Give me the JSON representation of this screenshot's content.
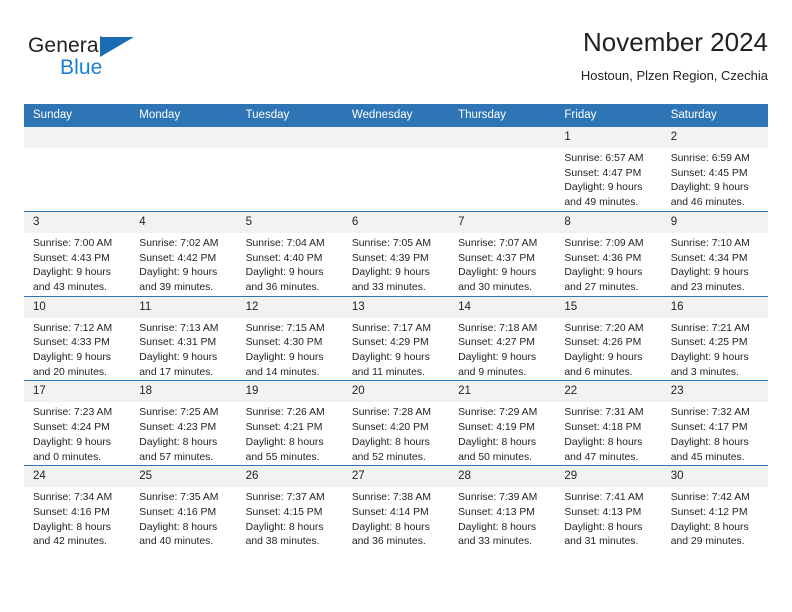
{
  "brand": {
    "word1": "General",
    "word2": "Blue",
    "triangle_color": "#1b6cb3",
    "blue_color": "#1b7ed6"
  },
  "header": {
    "title": "November 2024",
    "subtitle": "Hostoun, Plzen Region, Czechia"
  },
  "theme": {
    "header_bg": "#2e75b6",
    "daynum_bg": "#f2f2f2",
    "text": "#231f20"
  },
  "calendar": {
    "weekday_headers": [
      "Sunday",
      "Monday",
      "Tuesday",
      "Wednesday",
      "Thursday",
      "Friday",
      "Saturday"
    ],
    "weeks": [
      [
        {
          "day": "",
          "empty": true
        },
        {
          "day": "",
          "empty": true
        },
        {
          "day": "",
          "empty": true
        },
        {
          "day": "",
          "empty": true
        },
        {
          "day": "",
          "empty": true
        },
        {
          "day": "1",
          "sunrise": "Sunrise: 6:57 AM",
          "sunset": "Sunset: 4:47 PM",
          "daylight_1": "Daylight: 9 hours",
          "daylight_2": "and 49 minutes."
        },
        {
          "day": "2",
          "sunrise": "Sunrise: 6:59 AM",
          "sunset": "Sunset: 4:45 PM",
          "daylight_1": "Daylight: 9 hours",
          "daylight_2": "and 46 minutes."
        }
      ],
      [
        {
          "day": "3",
          "sunrise": "Sunrise: 7:00 AM",
          "sunset": "Sunset: 4:43 PM",
          "daylight_1": "Daylight: 9 hours",
          "daylight_2": "and 43 minutes."
        },
        {
          "day": "4",
          "sunrise": "Sunrise: 7:02 AM",
          "sunset": "Sunset: 4:42 PM",
          "daylight_1": "Daylight: 9 hours",
          "daylight_2": "and 39 minutes."
        },
        {
          "day": "5",
          "sunrise": "Sunrise: 7:04 AM",
          "sunset": "Sunset: 4:40 PM",
          "daylight_1": "Daylight: 9 hours",
          "daylight_2": "and 36 minutes."
        },
        {
          "day": "6",
          "sunrise": "Sunrise: 7:05 AM",
          "sunset": "Sunset: 4:39 PM",
          "daylight_1": "Daylight: 9 hours",
          "daylight_2": "and 33 minutes."
        },
        {
          "day": "7",
          "sunrise": "Sunrise: 7:07 AM",
          "sunset": "Sunset: 4:37 PM",
          "daylight_1": "Daylight: 9 hours",
          "daylight_2": "and 30 minutes."
        },
        {
          "day": "8",
          "sunrise": "Sunrise: 7:09 AM",
          "sunset": "Sunset: 4:36 PM",
          "daylight_1": "Daylight: 9 hours",
          "daylight_2": "and 27 minutes."
        },
        {
          "day": "9",
          "sunrise": "Sunrise: 7:10 AM",
          "sunset": "Sunset: 4:34 PM",
          "daylight_1": "Daylight: 9 hours",
          "daylight_2": "and 23 minutes."
        }
      ],
      [
        {
          "day": "10",
          "sunrise": "Sunrise: 7:12 AM",
          "sunset": "Sunset: 4:33 PM",
          "daylight_1": "Daylight: 9 hours",
          "daylight_2": "and 20 minutes."
        },
        {
          "day": "11",
          "sunrise": "Sunrise: 7:13 AM",
          "sunset": "Sunset: 4:31 PM",
          "daylight_1": "Daylight: 9 hours",
          "daylight_2": "and 17 minutes."
        },
        {
          "day": "12",
          "sunrise": "Sunrise: 7:15 AM",
          "sunset": "Sunset: 4:30 PM",
          "daylight_1": "Daylight: 9 hours",
          "daylight_2": "and 14 minutes."
        },
        {
          "day": "13",
          "sunrise": "Sunrise: 7:17 AM",
          "sunset": "Sunset: 4:29 PM",
          "daylight_1": "Daylight: 9 hours",
          "daylight_2": "and 11 minutes."
        },
        {
          "day": "14",
          "sunrise": "Sunrise: 7:18 AM",
          "sunset": "Sunset: 4:27 PM",
          "daylight_1": "Daylight: 9 hours",
          "daylight_2": "and 9 minutes."
        },
        {
          "day": "15",
          "sunrise": "Sunrise: 7:20 AM",
          "sunset": "Sunset: 4:26 PM",
          "daylight_1": "Daylight: 9 hours",
          "daylight_2": "and 6 minutes."
        },
        {
          "day": "16",
          "sunrise": "Sunrise: 7:21 AM",
          "sunset": "Sunset: 4:25 PM",
          "daylight_1": "Daylight: 9 hours",
          "daylight_2": "and 3 minutes."
        }
      ],
      [
        {
          "day": "17",
          "sunrise": "Sunrise: 7:23 AM",
          "sunset": "Sunset: 4:24 PM",
          "daylight_1": "Daylight: 9 hours",
          "daylight_2": "and 0 minutes."
        },
        {
          "day": "18",
          "sunrise": "Sunrise: 7:25 AM",
          "sunset": "Sunset: 4:23 PM",
          "daylight_1": "Daylight: 8 hours",
          "daylight_2": "and 57 minutes."
        },
        {
          "day": "19",
          "sunrise": "Sunrise: 7:26 AM",
          "sunset": "Sunset: 4:21 PM",
          "daylight_1": "Daylight: 8 hours",
          "daylight_2": "and 55 minutes."
        },
        {
          "day": "20",
          "sunrise": "Sunrise: 7:28 AM",
          "sunset": "Sunset: 4:20 PM",
          "daylight_1": "Daylight: 8 hours",
          "daylight_2": "and 52 minutes."
        },
        {
          "day": "21",
          "sunrise": "Sunrise: 7:29 AM",
          "sunset": "Sunset: 4:19 PM",
          "daylight_1": "Daylight: 8 hours",
          "daylight_2": "and 50 minutes."
        },
        {
          "day": "22",
          "sunrise": "Sunrise: 7:31 AM",
          "sunset": "Sunset: 4:18 PM",
          "daylight_1": "Daylight: 8 hours",
          "daylight_2": "and 47 minutes."
        },
        {
          "day": "23",
          "sunrise": "Sunrise: 7:32 AM",
          "sunset": "Sunset: 4:17 PM",
          "daylight_1": "Daylight: 8 hours",
          "daylight_2": "and 45 minutes."
        }
      ],
      [
        {
          "day": "24",
          "sunrise": "Sunrise: 7:34 AM",
          "sunset": "Sunset: 4:16 PM",
          "daylight_1": "Daylight: 8 hours",
          "daylight_2": "and 42 minutes."
        },
        {
          "day": "25",
          "sunrise": "Sunrise: 7:35 AM",
          "sunset": "Sunset: 4:16 PM",
          "daylight_1": "Daylight: 8 hours",
          "daylight_2": "and 40 minutes."
        },
        {
          "day": "26",
          "sunrise": "Sunrise: 7:37 AM",
          "sunset": "Sunset: 4:15 PM",
          "daylight_1": "Daylight: 8 hours",
          "daylight_2": "and 38 minutes."
        },
        {
          "day": "27",
          "sunrise": "Sunrise: 7:38 AM",
          "sunset": "Sunset: 4:14 PM",
          "daylight_1": "Daylight: 8 hours",
          "daylight_2": "and 36 minutes."
        },
        {
          "day": "28",
          "sunrise": "Sunrise: 7:39 AM",
          "sunset": "Sunset: 4:13 PM",
          "daylight_1": "Daylight: 8 hours",
          "daylight_2": "and 33 minutes."
        },
        {
          "day": "29",
          "sunrise": "Sunrise: 7:41 AM",
          "sunset": "Sunset: 4:13 PM",
          "daylight_1": "Daylight: 8 hours",
          "daylight_2": "and 31 minutes."
        },
        {
          "day": "30",
          "sunrise": "Sunrise: 7:42 AM",
          "sunset": "Sunset: 4:12 PM",
          "daylight_1": "Daylight: 8 hours",
          "daylight_2": "and 29 minutes."
        }
      ]
    ]
  }
}
